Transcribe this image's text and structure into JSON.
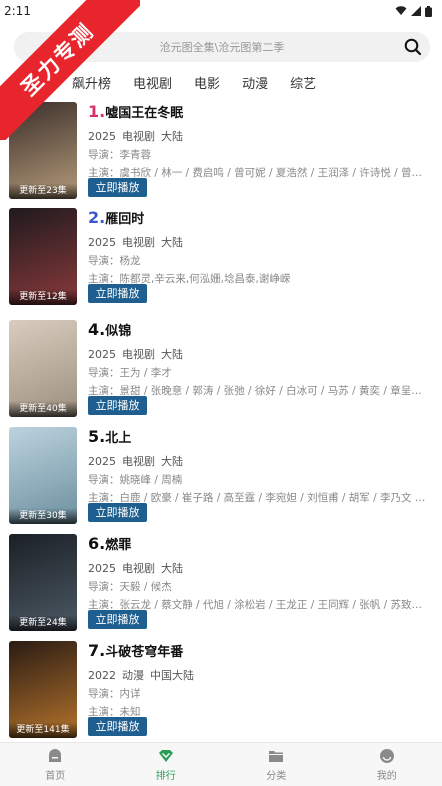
{
  "status": {
    "time": "2:11"
  },
  "watermark": {
    "text": "圣力专测"
  },
  "search": {
    "placeholder": "沧元图全集\\沧元图第二季"
  },
  "tabs": [
    {
      "label": "播榜",
      "active": true
    },
    {
      "label": "飙升榜"
    },
    {
      "label": "电视剧"
    },
    {
      "label": "电影"
    },
    {
      "label": "动漫"
    },
    {
      "label": "综艺"
    }
  ],
  "items": [
    {
      "rank": "1.",
      "title": "嘘国王在冬眠",
      "year": "2025",
      "type": "电视剧",
      "region": "大陆",
      "director": "导演：李青蓉",
      "cast": "主演：虞书欣 / 林一 / 费启鸣 / 曾可妮 / 夏浩然 / 王润泽 / 许诗悦 / 曾宥臻",
      "update": "更新至23集",
      "poster_colors": [
        "#3a2e2a",
        "#b59b7a"
      ]
    },
    {
      "rank": "2.",
      "title": "雁回时",
      "year": "2025",
      "type": "电视剧",
      "region": "大陆",
      "director": "导演：杨龙",
      "cast": "主演：陈都灵,辛云来,何泓姗,埝昌泰,谢峥嵘",
      "update": "更新至12集",
      "poster_colors": [
        "#1f1a1d",
        "#8a3a3c"
      ]
    },
    {
      "rank": "4.",
      "title": "似锦",
      "year": "2025",
      "type": "电视剧",
      "region": "大陆",
      "director": "导演：王为 / 李才",
      "cast": "主演：景甜 / 张晚意 / 郭涛 / 张弛 / 徐好 / 白冰可 / 马苏 / 黄奕 / 章呈赫 / ...",
      "update": "更新至40集",
      "poster_colors": [
        "#d8cdbf",
        "#9c8f7d"
      ]
    },
    {
      "rank": "5.",
      "title": "北上",
      "year": "2025",
      "type": "电视剧",
      "region": "大陆",
      "director": "导演：姚晓峰 / 周楠",
      "cast": "主演：白鹿 / 欧豪 / 崔子路 / 高至霆 / 李宛妲 / 刘恒甫 / 胡军 / 李乃文 / 岳...",
      "update": "更新至30集",
      "poster_colors": [
        "#bcd3de",
        "#6c8f9f"
      ]
    },
    {
      "rank": "6.",
      "title": "燃罪",
      "year": "2025",
      "type": "电视剧",
      "region": "大陆",
      "director": "导演：天毅 / 候杰",
      "cast": "主演：张云龙 / 蔡文静 / 代旭 / 涂松岩 / 王龙正 / 王同辉 / 张帆 / 苏致源 / ...",
      "update": "更新至24集",
      "poster_colors": [
        "#1b2026",
        "#4c5964"
      ]
    },
    {
      "rank": "7.",
      "title": "斗破苍穹年番",
      "year": "2022",
      "type": "动漫",
      "region": "中国大陆",
      "director": "导演：内详",
      "cast": "主演：未知",
      "update": "更新至141集",
      "poster_colors": [
        "#2a1c14",
        "#b5742c"
      ]
    }
  ],
  "play_label": "立即播放",
  "nav": [
    {
      "label": "首页",
      "icon": "home-icon"
    },
    {
      "label": "排行",
      "icon": "rank-icon",
      "active": true
    },
    {
      "label": "分类",
      "icon": "folder-icon"
    },
    {
      "label": "我的",
      "icon": "profile-icon"
    }
  ]
}
